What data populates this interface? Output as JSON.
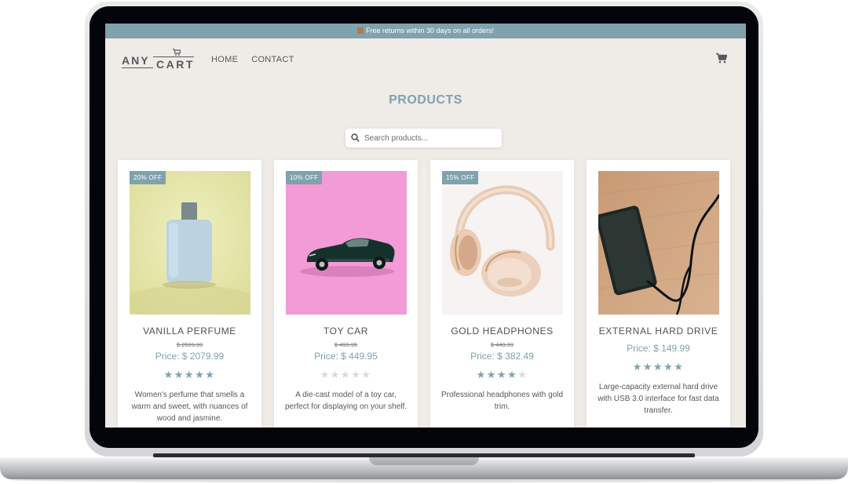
{
  "announcement": {
    "text": "Free returns within 30 days on all orders!",
    "icon": "box-icon"
  },
  "logo": {
    "line1": "ANY",
    "line2": "CART"
  },
  "nav": [
    {
      "label": "HOME"
    },
    {
      "label": "CONTACT"
    }
  ],
  "page_title": "PRODUCTS",
  "search": {
    "placeholder": "Search products...",
    "value": ""
  },
  "colors": {
    "accent": "#7fa2ad",
    "background": "#efebe7",
    "text": "#55585c"
  },
  "products": [
    {
      "badge": "20% OFF",
      "name": "VANILLA PERFUME",
      "old_price": "$ 2599.99",
      "price": "Price: $ 2079.99",
      "rating": 5,
      "description": "Women's perfume that smells a warm and sweet, with nuances of wood and jasmine."
    },
    {
      "badge": "10% OFF",
      "name": "TOY CAR",
      "old_price": "$ 499.95",
      "price": "Price: $ 449.95",
      "rating": 0,
      "description": "A die-cast model of a toy car, perfect for displaying on your shelf."
    },
    {
      "badge": "15% OFF",
      "name": "GOLD HEADPHONES",
      "old_price": "$ 449.99",
      "price": "Price: $ 382.49",
      "rating": 4,
      "description": "Professional headphones with gold trim."
    },
    {
      "badge": "",
      "name": "EXTERNAL HARD DRIVE",
      "old_price": "",
      "price": "Price: $ 149.99",
      "rating": 5,
      "description": "Large-capacity external hard drive with USB 3.0 interface for fast data transfer."
    }
  ]
}
